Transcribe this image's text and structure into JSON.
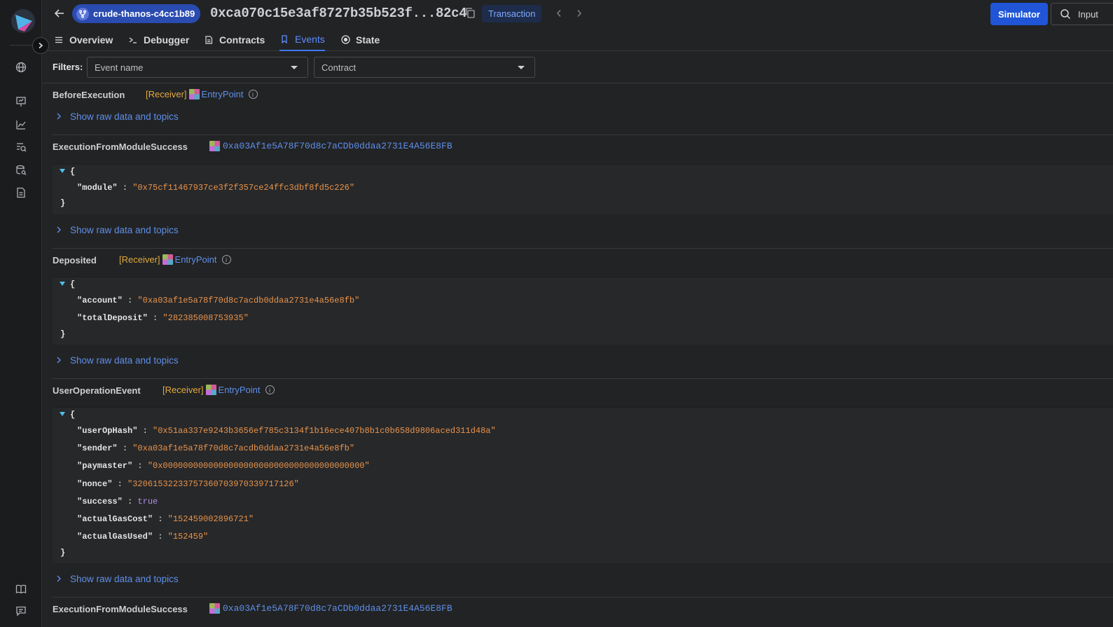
{
  "project": {
    "name": "crude-thanos-c4cc1b89"
  },
  "tx": {
    "hash": "0xca070c15e3af8727b35b523f...82c4",
    "badge": "Transaction"
  },
  "toolbar": {
    "simulator_label": "Simulator",
    "search_placeholder": "Input"
  },
  "tabs": [
    {
      "label": "Overview",
      "icon": "list-icon"
    },
    {
      "label": "Debugger",
      "icon": "terminal-icon"
    },
    {
      "label": "Contracts",
      "icon": "file-icon"
    },
    {
      "label": "Events",
      "icon": "bookmark-icon"
    },
    {
      "label": "State",
      "icon": "target-icon"
    }
  ],
  "active_tab": "Events",
  "filters": {
    "label": "Filters:",
    "event_name": "Event name",
    "contract": "Contract"
  },
  "raw_toggle_label": "Show raw data and topics",
  "events": [
    {
      "name": "BeforeExecution",
      "receiver_tag": "[Receiver]",
      "contract": "EntryPoint"
    },
    {
      "name": "ExecutionFromModuleSuccess",
      "address": "0xa03Af1e5A78F70d8c7aCDb0ddaa2731E4A56E8FB",
      "params": [
        {
          "key": "\"module\"",
          "value": "\"0x75cf11467937ce3f2f357ce24ffc3dbf8fd5c226\""
        }
      ]
    },
    {
      "name": "Deposited",
      "receiver_tag": "[Receiver]",
      "contract": "EntryPoint",
      "params": [
        {
          "key": "\"account\"",
          "value": "\"0xa03af1e5a78f70d8c7acdb0ddaa2731e4a56e8fb\""
        },
        {
          "key": "\"totalDeposit\"",
          "value": "\"282385008753935\""
        }
      ]
    },
    {
      "name": "UserOperationEvent",
      "receiver_tag": "[Receiver]",
      "contract": "EntryPoint",
      "params": [
        {
          "key": "\"userOpHash\"",
          "value": "\"0x51aa337e9243b3656ef785c3134f1b16ece407b8b1c0b658d9806aced311d48a\""
        },
        {
          "key": "\"sender\"",
          "value": "\"0xa03af1e5a78f70d8c7acdb0ddaa2731e4a56e8fb\""
        },
        {
          "key": "\"paymaster\"",
          "value": "\"0x0000000000000000000000000000000000000000\""
        },
        {
          "key": "\"nonce\"",
          "value": "\"32061532233757360703970339717126\""
        },
        {
          "key": "\"success\"",
          "value": "true"
        },
        {
          "key": "\"actualGasCost\"",
          "value": "\"152459002896721\""
        },
        {
          "key": "\"actualGasUsed\"",
          "value": "\"152459\""
        }
      ]
    },
    {
      "name": "ExecutionFromModuleSuccess",
      "address": "0xa03Af1e5A78F70d8c7aCDb0ddaa2731E4A56E8FB"
    }
  ],
  "json_glyphs": {
    "open": "{",
    "close": "}",
    "colon": ":"
  },
  "colors": {
    "accent": "#1f55d6",
    "link": "#5f8fe8",
    "receiver": "#e2a93f",
    "json_string": "#e8934b",
    "json_bool": "#b48ee8"
  }
}
